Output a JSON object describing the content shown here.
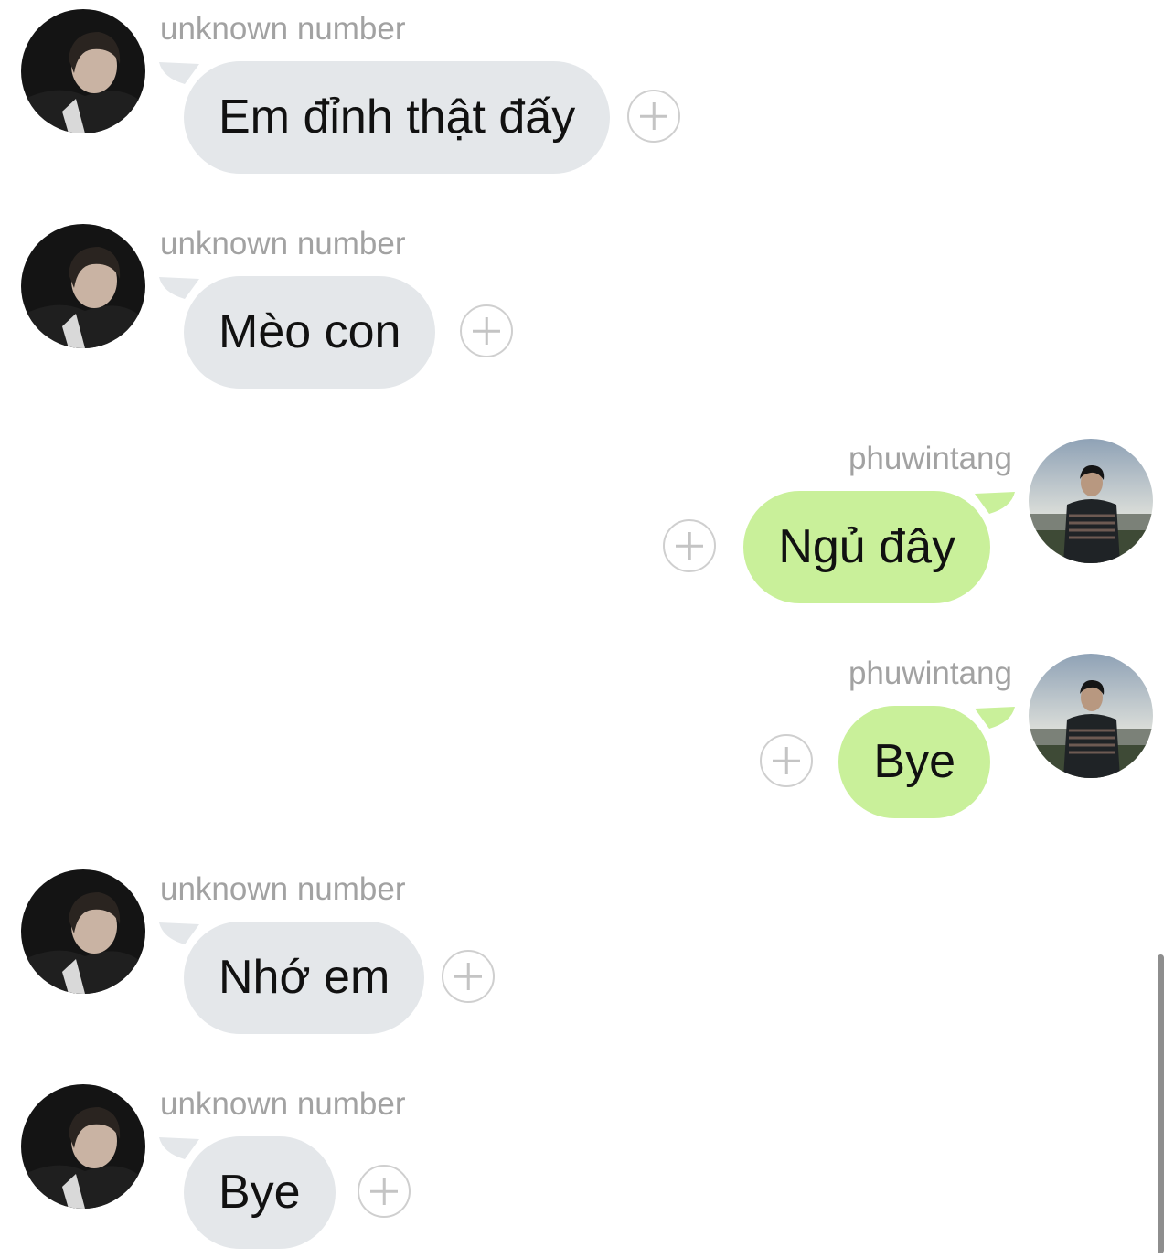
{
  "colors": {
    "incoming_bubble": "#e4e7ea",
    "outgoing_bubble": "#c9f09a",
    "sender_name": "#a2a2a2",
    "add_button": "#cfcfcf"
  },
  "messages": [
    {
      "sender": "unknown number",
      "text": "Em đỉnh thật đấy",
      "direction": "incoming",
      "action_icon": "add-circle-icon"
    },
    {
      "sender": "unknown number",
      "text": "Mèo con",
      "direction": "incoming",
      "action_icon": "add-circle-icon"
    },
    {
      "sender": "phuwintang",
      "text": "Ngủ đây",
      "direction": "outgoing",
      "action_icon": "add-circle-icon"
    },
    {
      "sender": "phuwintang",
      "text": "Bye",
      "direction": "outgoing",
      "action_icon": "add-circle-icon"
    },
    {
      "sender": "unknown number",
      "text": "Nhớ em",
      "direction": "incoming",
      "action_icon": "add-circle-icon"
    },
    {
      "sender": "unknown number",
      "text": "Bye",
      "direction": "incoming",
      "action_icon": "add-circle-icon"
    }
  ]
}
